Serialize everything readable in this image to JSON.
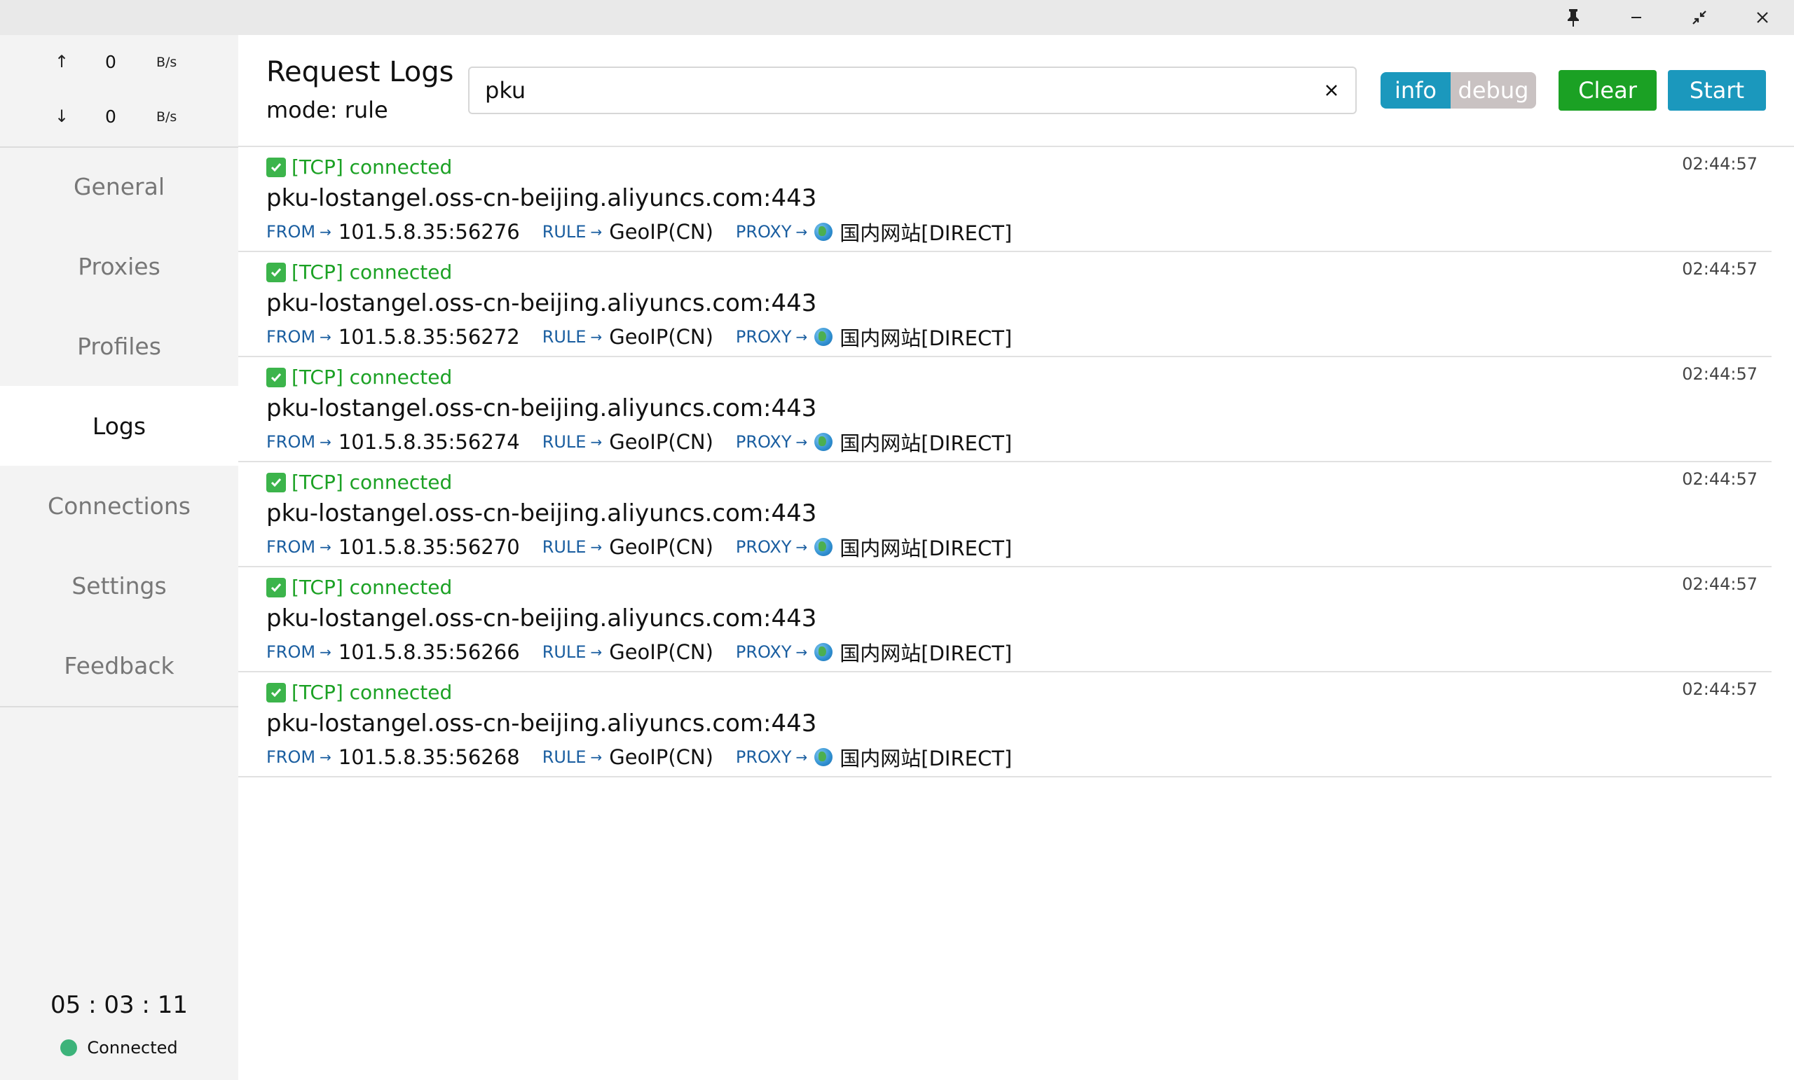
{
  "titlebar": {
    "pin_icon": "pin-icon",
    "minimize_icon": "minimize-icon",
    "restore_icon": "restore-icon",
    "close_icon": "close-icon"
  },
  "sidebar": {
    "traffic": {
      "up_arrow": "↑",
      "up_value": "0",
      "up_unit": "B/s",
      "down_arrow": "↓",
      "down_value": "0",
      "down_unit": "B/s"
    },
    "nav": [
      {
        "label": "General",
        "active": false
      },
      {
        "label": "Proxies",
        "active": false
      },
      {
        "label": "Profiles",
        "active": false
      },
      {
        "label": "Logs",
        "active": true
      },
      {
        "label": "Connections",
        "active": false
      },
      {
        "label": "Settings",
        "active": false
      },
      {
        "label": "Feedback",
        "active": false
      }
    ],
    "timer": "05 : 03 : 11",
    "status": "Connected",
    "status_color": "#3cb37a"
  },
  "header": {
    "title": "Request Logs",
    "mode": "mode: rule",
    "search_value": "pku",
    "level_options": [
      "info",
      "debug"
    ],
    "level_selected": "info",
    "clear_label": "Clear",
    "start_label": "Start",
    "colors": {
      "info": "#1b98bd",
      "clear": "#1ba124",
      "start": "#1b98bd"
    }
  },
  "logs": [
    {
      "status": "[TCP] connected",
      "time": "02:44:57",
      "host": "pku-lostangel.oss-cn-beijing.aliyuncs.com:443",
      "from_key": "FROM",
      "from": "101.5.8.35:56276",
      "rule_key": "RULE",
      "rule": "GeoIP(CN)",
      "proxy_key": "PROXY",
      "proxy": "国内网站[DIRECT]"
    },
    {
      "status": "[TCP] connected",
      "time": "02:44:57",
      "host": "pku-lostangel.oss-cn-beijing.aliyuncs.com:443",
      "from_key": "FROM",
      "from": "101.5.8.35:56272",
      "rule_key": "RULE",
      "rule": "GeoIP(CN)",
      "proxy_key": "PROXY",
      "proxy": "国内网站[DIRECT]"
    },
    {
      "status": "[TCP] connected",
      "time": "02:44:57",
      "host": "pku-lostangel.oss-cn-beijing.aliyuncs.com:443",
      "from_key": "FROM",
      "from": "101.5.8.35:56274",
      "rule_key": "RULE",
      "rule": "GeoIP(CN)",
      "proxy_key": "PROXY",
      "proxy": "国内网站[DIRECT]"
    },
    {
      "status": "[TCP] connected",
      "time": "02:44:57",
      "host": "pku-lostangel.oss-cn-beijing.aliyuncs.com:443",
      "from_key": "FROM",
      "from": "101.5.8.35:56270",
      "rule_key": "RULE",
      "rule": "GeoIP(CN)",
      "proxy_key": "PROXY",
      "proxy": "国内网站[DIRECT]"
    },
    {
      "status": "[TCP] connected",
      "time": "02:44:57",
      "host": "pku-lostangel.oss-cn-beijing.aliyuncs.com:443",
      "from_key": "FROM",
      "from": "101.5.8.35:56266",
      "rule_key": "RULE",
      "rule": "GeoIP(CN)",
      "proxy_key": "PROXY",
      "proxy": "国内网站[DIRECT]"
    },
    {
      "status": "[TCP] connected",
      "time": "02:44:57",
      "host": "pku-lostangel.oss-cn-beijing.aliyuncs.com:443",
      "from_key": "FROM",
      "from": "101.5.8.35:56268",
      "rule_key": "RULE",
      "rule": "GeoIP(CN)",
      "proxy_key": "PROXY",
      "proxy": "国内网站[DIRECT]"
    }
  ]
}
